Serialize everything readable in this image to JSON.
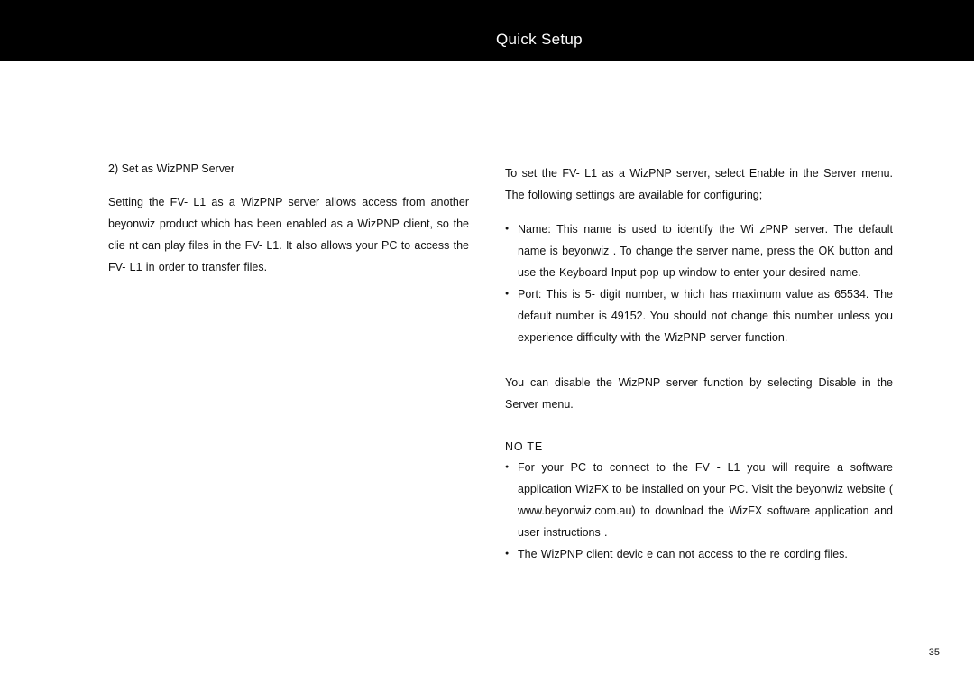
{
  "header": {
    "title": "Quick Setup"
  },
  "left": {
    "subheading": "2)  Set as WizPNP Server",
    "paragraph": "Setting  the    FV- L1  as  a  WizPNP  server  allows  access  from  another beyonwiz  product  which  has  been  enabled  as  a  WizPNP  client,  so  the clie nt can play  files in     the  FV- L1.   It also  allows your PC to  access  the FV- L1  in order to transfer files."
  },
  "right": {
    "intro": "To  set  the    FV- L1  as  a  WizPNP  server,  select   Enable   in  the   Server  menu.     The following settings are available        for configuring;",
    "bullets_main": [
      "Name:   This name is used to identify the Wi       zPNP server.     The default name   is   beyonwiz .         To  change  the  server  name,  press  the        OK button  and  use  the   Keyboard  Input   pop-up  window  to  enter   your  desired name.",
      "Port:  This  is  5-    digit  number,  w    hich  has  maximum  value  as  65534.   The  default  number  is  49152.          You  should  not  change  this  number unless you experience difficulty with the WizPNP server function."
    ],
    "disable_para": "You can disable the WizPNP server function by selecting  Disable  in the  Server  menu.",
    "note_label": "NO TE",
    "bullets_note": [
      "For  your  PC  to  connect  to  the  FV      - L1   you  will  require  a  software application   WizFX   to  be  installed  on  your  PC.           Visit  the  beyonwiz website  (   www.beyonwiz.com.au)       to  download  the   WizFX   software application and user instructions        .",
      "The WizPNP client devic    e can not   access  to  the  re cording   files."
    ]
  },
  "page_number": "35"
}
